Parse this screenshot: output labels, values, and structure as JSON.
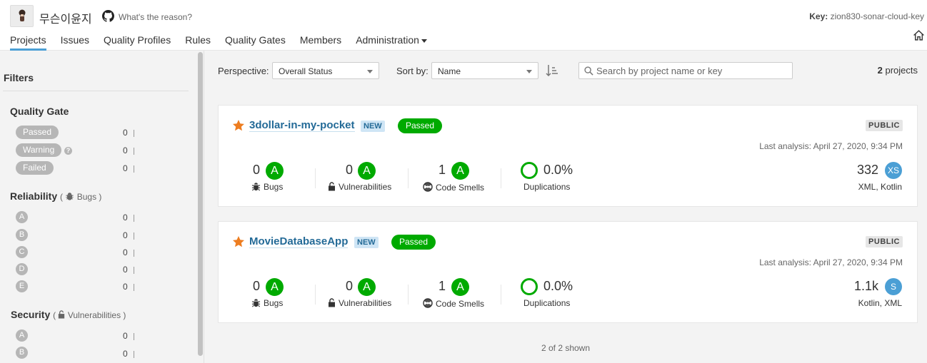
{
  "header": {
    "org_name": "무슨이윤지",
    "org_description": "What's the reason?",
    "key_label": "Key:",
    "key_value": "zion830-sonar-cloud-key"
  },
  "nav": {
    "tabs": [
      "Projects",
      "Issues",
      "Quality Profiles",
      "Rules",
      "Quality Gates",
      "Members",
      "Administration"
    ],
    "active": "Projects"
  },
  "sidebar": {
    "title": "Filters",
    "quality_gate": {
      "title": "Quality Gate",
      "items": [
        {
          "label": "Passed",
          "count": "0"
        },
        {
          "label": "Warning",
          "count": "0"
        },
        {
          "label": "Failed",
          "count": "0"
        }
      ]
    },
    "reliability": {
      "title": "Reliability",
      "sub": "Bugs",
      "items": [
        {
          "label": "A",
          "count": "0"
        },
        {
          "label": "B",
          "count": "0"
        },
        {
          "label": "C",
          "count": "0"
        },
        {
          "label": "D",
          "count": "0"
        },
        {
          "label": "E",
          "count": "0"
        }
      ]
    },
    "security": {
      "title": "Security",
      "sub": "Vulnerabilities",
      "items": [
        {
          "label": "A",
          "count": "0"
        },
        {
          "label": "B",
          "count": "0"
        }
      ]
    }
  },
  "toolbar": {
    "perspective_label": "Perspective:",
    "perspective_value": "Overall Status",
    "sort_label": "Sort by:",
    "sort_value": "Name",
    "search_placeholder": "Search by project name or key",
    "project_count": "2",
    "project_count_suffix": "projects"
  },
  "projects": [
    {
      "name": "3dollar-in-my-pocket",
      "new_badge": "NEW",
      "gate": "Passed",
      "visibility": "PUBLIC",
      "last_analysis": "Last analysis: April 27, 2020, 9:34 PM",
      "bugs": "0",
      "bugs_rating": "A",
      "bugs_label": "Bugs",
      "vulns": "0",
      "vulns_rating": "A",
      "vulns_label": "Vulnerabilities",
      "smells": "1",
      "smells_rating": "A",
      "smells_label": "Code Smells",
      "dup": "0.0%",
      "dup_label": "Duplications",
      "size": "332",
      "size_rating": "XS",
      "languages": "XML, Kotlin"
    },
    {
      "name": "MovieDatabaseApp",
      "new_badge": "NEW",
      "gate": "Passed",
      "visibility": "PUBLIC",
      "last_analysis": "Last analysis: April 27, 2020, 9:34 PM",
      "bugs": "0",
      "bugs_rating": "A",
      "bugs_label": "Bugs",
      "vulns": "0",
      "vulns_rating": "A",
      "vulns_label": "Vulnerabilities",
      "smells": "1",
      "smells_rating": "A",
      "smells_label": "Code Smells",
      "dup": "0.0%",
      "dup_label": "Duplications",
      "size": "1.1k",
      "size_rating": "S",
      "languages": "Kotlin, XML"
    }
  ],
  "footer": {
    "shown": "2 of 2 shown"
  },
  "colors": {
    "passed": "#00aa00",
    "link": "#236a97",
    "accent": "#4b9fd5",
    "star": "#ed7d20"
  }
}
